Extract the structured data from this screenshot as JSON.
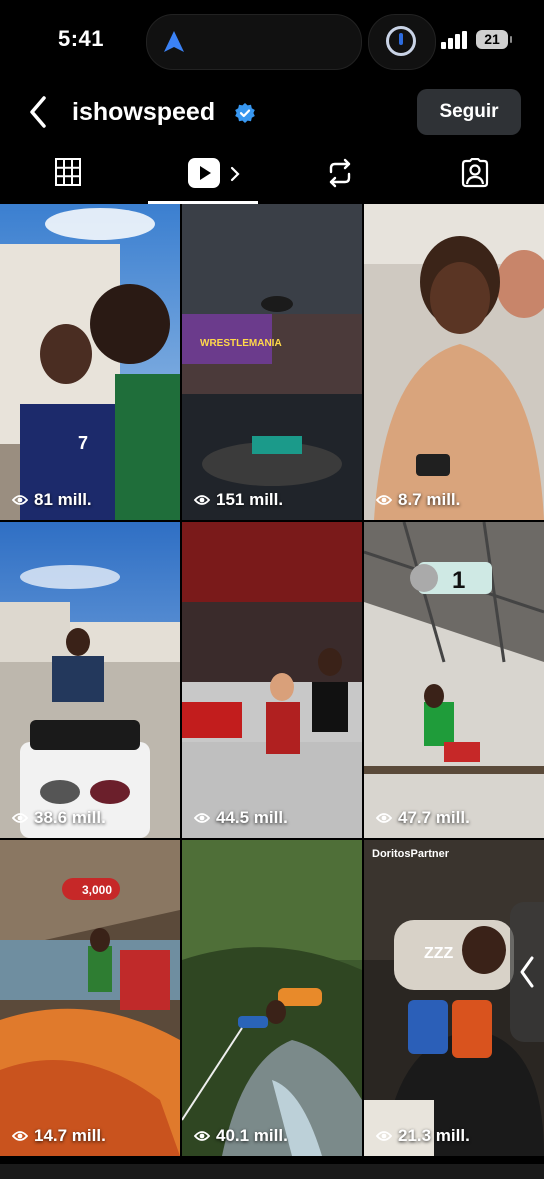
{
  "status_bar": {
    "time": "5:41",
    "battery": "21"
  },
  "header": {
    "username": "ishowspeed",
    "follow_label": "Seguir"
  },
  "tabs": [
    {
      "name": "grid"
    },
    {
      "name": "reels",
      "active": true
    },
    {
      "name": "reposts"
    },
    {
      "name": "tagged"
    }
  ],
  "posts": [
    {
      "views": "81 mill."
    },
    {
      "views": "151 mill."
    },
    {
      "views": "8.7 mill."
    },
    {
      "views": "38.6 mill."
    },
    {
      "views": "44.5 mill."
    },
    {
      "views": "47.7 mill."
    },
    {
      "views": "14.7 mill."
    },
    {
      "views": "40.1 mill."
    },
    {
      "views": "21.3 mill."
    }
  ],
  "overlays": {
    "wrestlemania": "WRESTLEMANIA",
    "badge_one": "1",
    "badge_3000": "3,000",
    "doritos": "DoritosPartner",
    "zzz": "ZZZ"
  },
  "colors": {
    "accent": "#2d6cdf",
    "verified": "#3897f0"
  }
}
